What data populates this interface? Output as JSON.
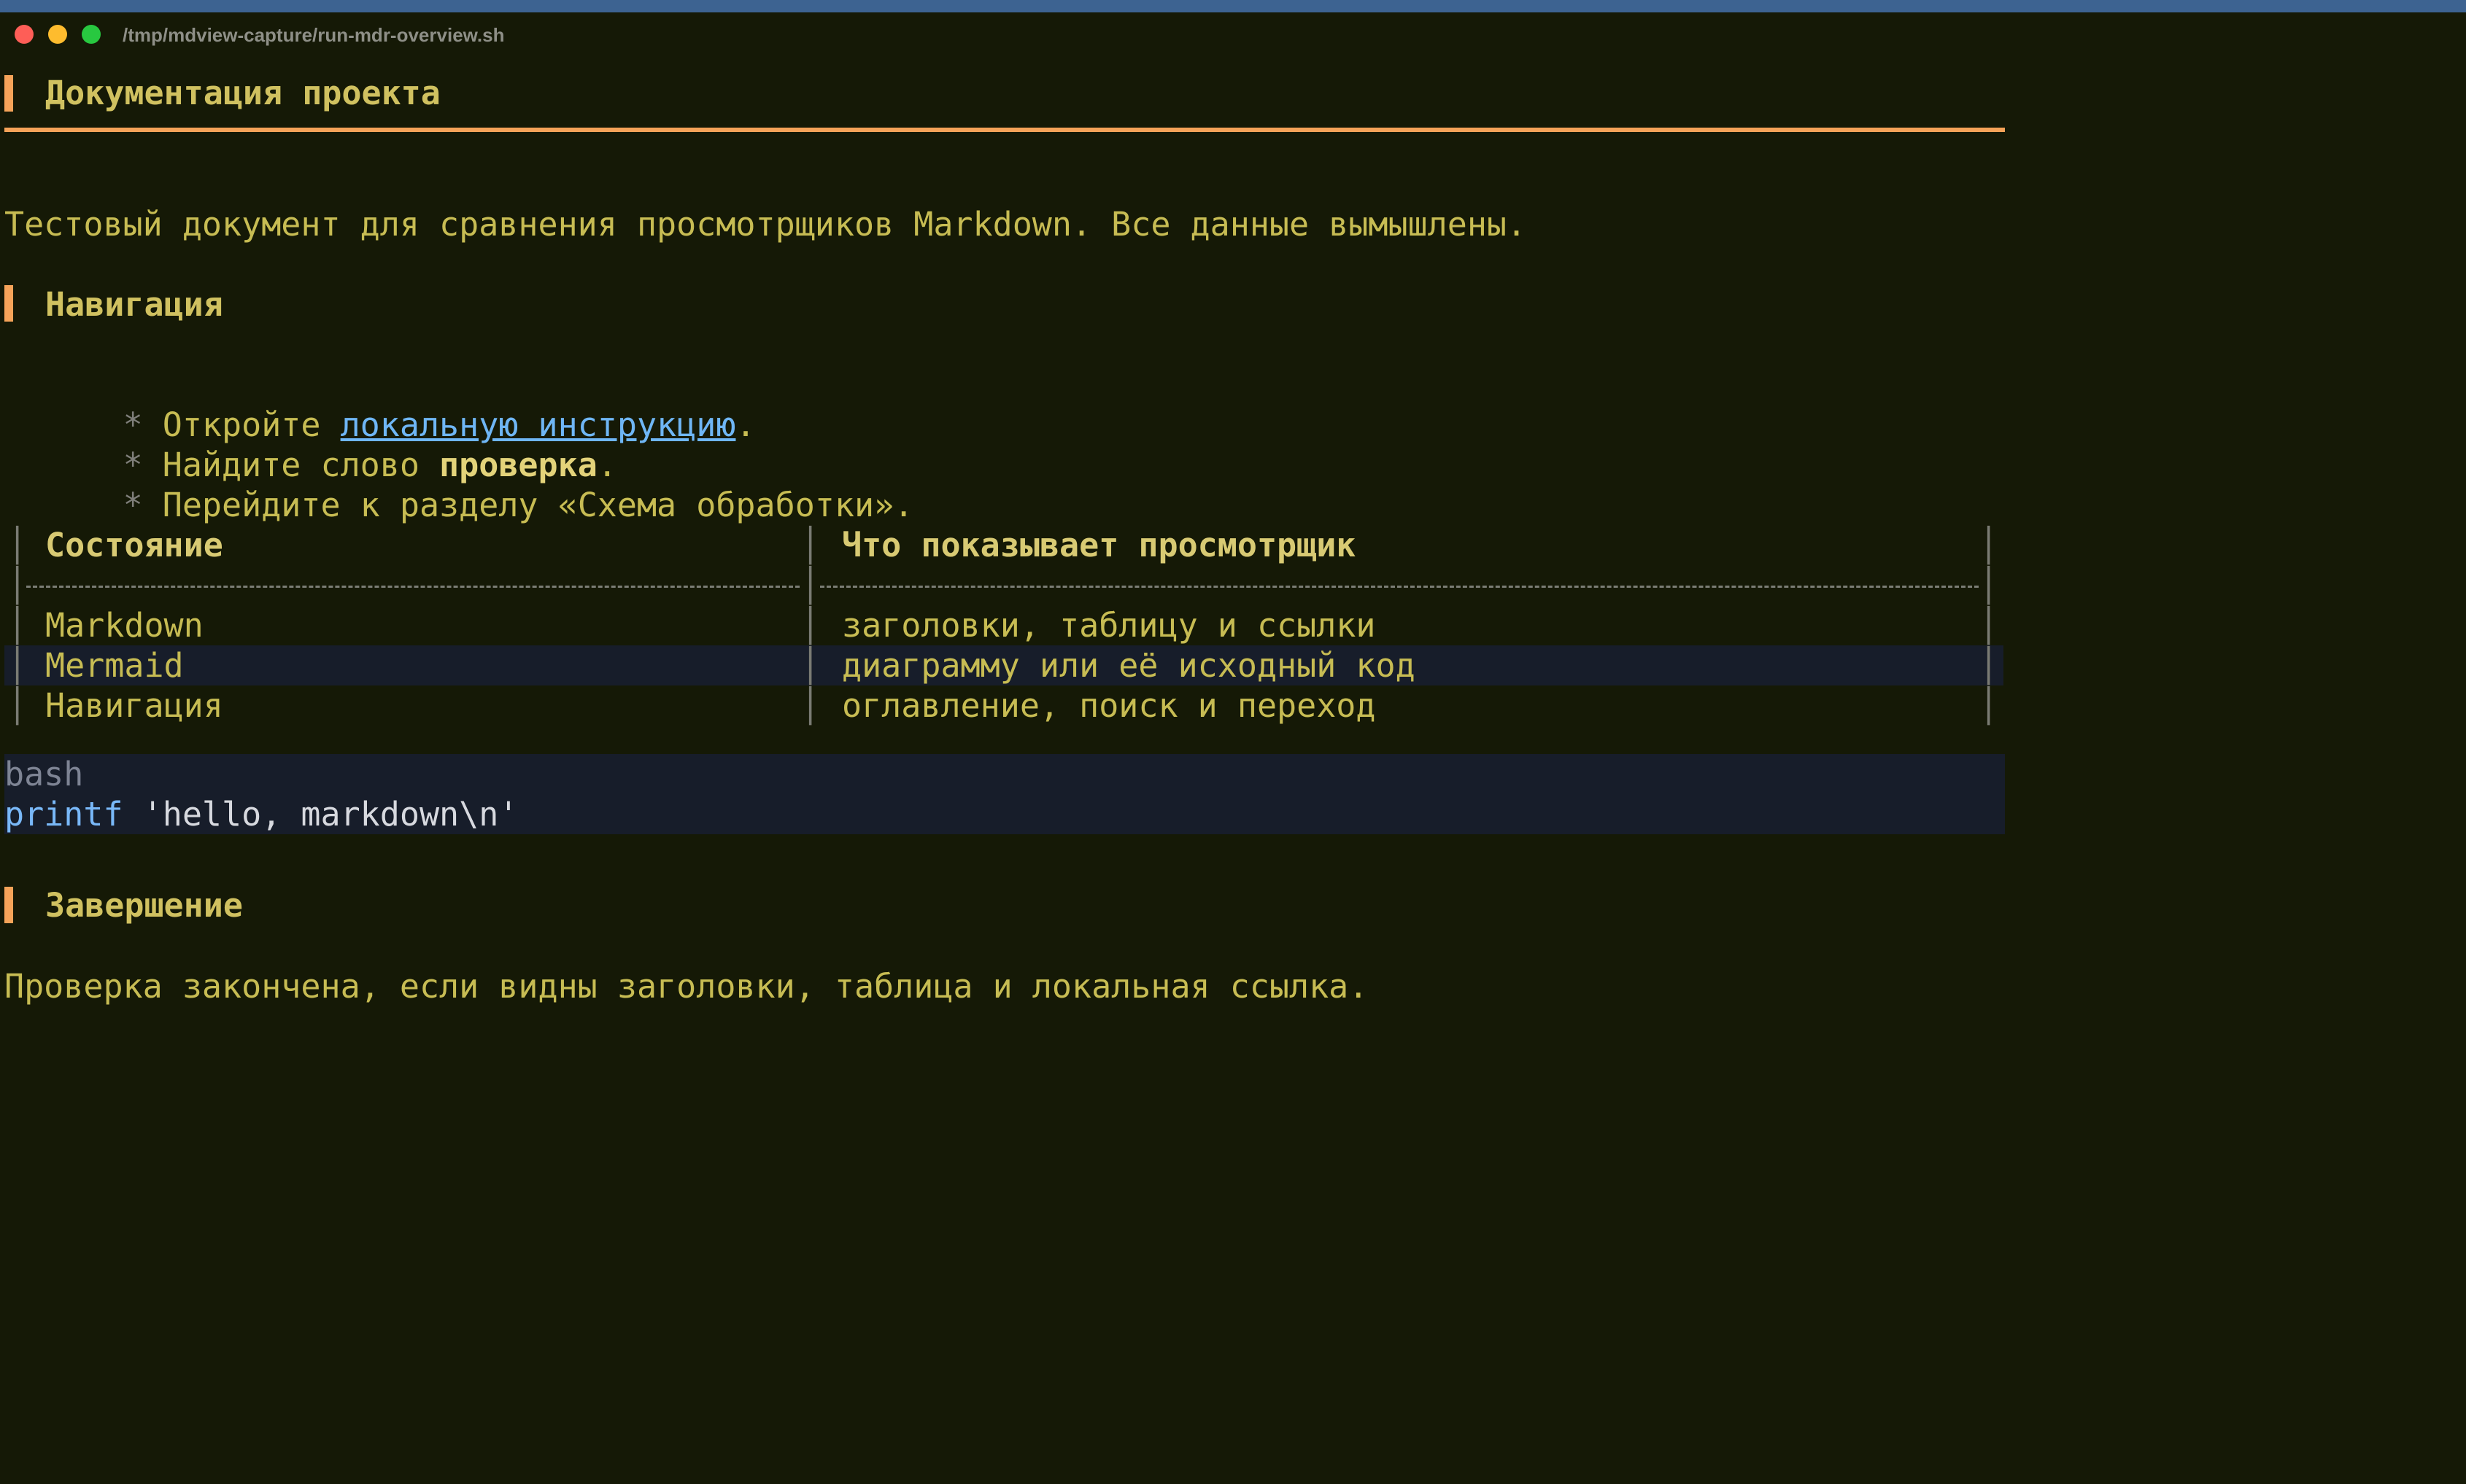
{
  "window": {
    "title": "/tmp/mdview-capture/run-mdr-overview.sh"
  },
  "colors": {
    "accent_orange": "#f5a359",
    "text_yellow": "#c7bc53",
    "heading_yellow": "#d0c160",
    "link_blue": "#6fb6f5",
    "bg_dark": "#151906",
    "traffic_close": "#fe5e57",
    "traffic_min": "#febc2e",
    "traffic_max": "#28c840"
  },
  "document": {
    "title": "Документация проекта",
    "intro": "Тестовый документ для сравнения просмотрщиков Markdown. Все данные вымышлены.",
    "nav_heading": "Навигация",
    "bullets": [
      {
        "prefix": "Откройте ",
        "link": "локальную инструкцию",
        "suffix": "."
      },
      {
        "prefix": "Найдите слово ",
        "strong": "проверка",
        "suffix": "."
      },
      {
        "text": "Перейдите к разделу «Схема обработки»."
      }
    ],
    "bullet_marker": "*",
    "table": {
      "headers": [
        "Состояние",
        "Что показывает просмотрщик"
      ],
      "rows": [
        [
          "Markdown",
          "заголовки, таблицу и ссылки"
        ],
        [
          "Mermaid",
          "диаграмму или её исходный код"
        ],
        [
          "Навигация",
          "оглавление, поиск и переход"
        ]
      ]
    },
    "code": {
      "lang": "bash",
      "keyword": "printf",
      "rest": " 'hello, markdown\\n'"
    },
    "final_heading": "Завершение",
    "final_text": "Проверка закончена, если видны заголовки, таблица и локальная ссылка."
  }
}
